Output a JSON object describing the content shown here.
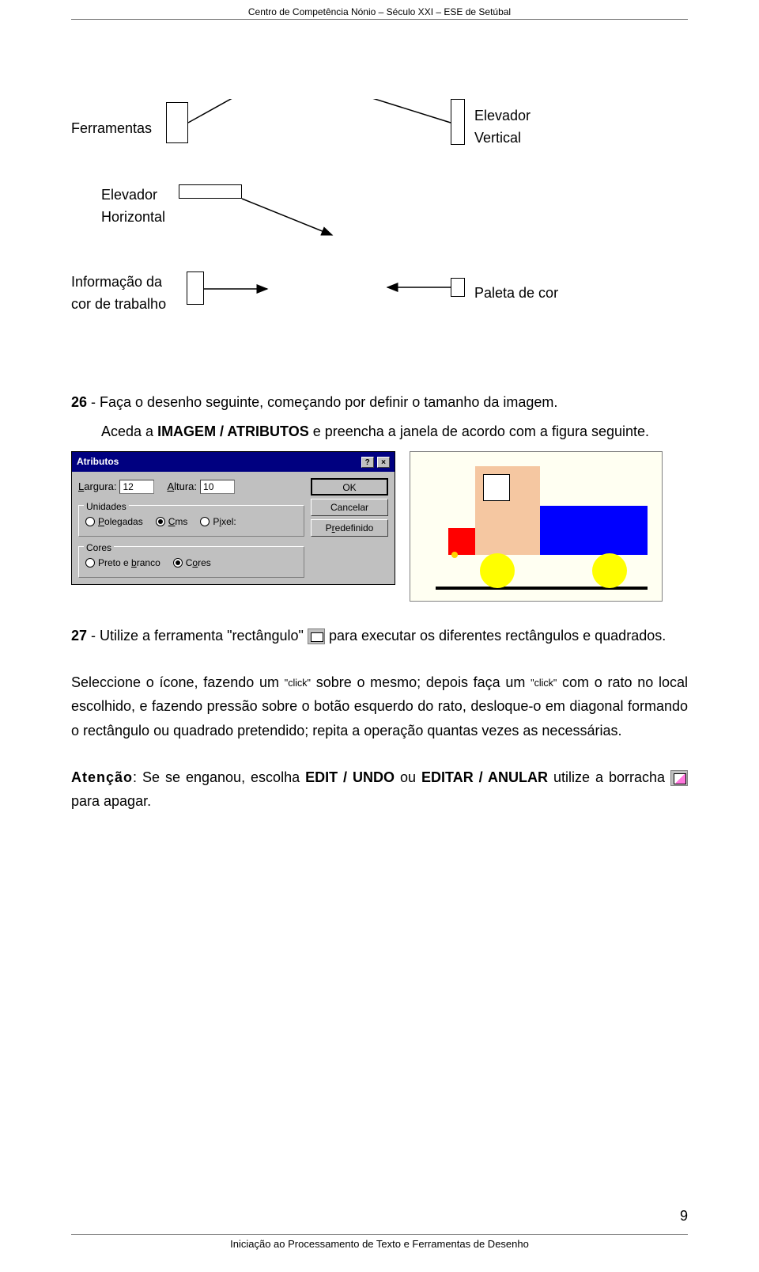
{
  "header": {
    "title": "Centro de Competência Nónio – Século XXI – ESE de Setúbal"
  },
  "diagram": {
    "ferramentas": "Ferramentas",
    "elevador_v1": "Elevador",
    "elevador_v2": "Vertical",
    "elevador_h1": "Elevador",
    "elevador_h2": "Horizontal",
    "info1": "Informação da",
    "info2": "cor de trabalho",
    "paleta": "Paleta de cor"
  },
  "step26": {
    "num": "26",
    "text_a": " - Faça o desenho seguinte, começando por definir o tamanho da imagem.",
    "text_b1": "Aceda a ",
    "text_b_bold": "IMAGEM / ATRIBUTOS",
    "text_b2": " e preencha a janela de acordo com a figura seguinte."
  },
  "dialog": {
    "title": "Atributos",
    "help": "?",
    "close": "×",
    "largura_lbl": "Largura:",
    "largura_val": "12",
    "altura_lbl": "Altura:",
    "altura_val": "10",
    "grp_unidades": "Unidades",
    "u_pol": "Polegadas",
    "u_cms": "Cms",
    "u_pix": "Pixel:",
    "grp_cores": "Cores",
    "c_pb": "Preto e branco",
    "c_cor": "Cores",
    "btn_ok": "OK",
    "btn_cancel": "Cancelar",
    "btn_predef": "Predefinido"
  },
  "step27": {
    "num": "27",
    "a": " - Utilize a ferramenta \"rectângulo\" ",
    "b": " para executar os diferentes rectângulos e quadrados.",
    "p2_a": "Seleccione o ícone, fazendo um ",
    "click": "\"click\"",
    "p2_b": " sobre o mesmo; depois faça um ",
    "p2_c": " com o rato no local escolhido, e fazendo pressão sobre o botão esquerdo do rato, desloque-o em diagonal formando o rectângulo ou quadrado pretendido; repita a operação quantas vezes as necessárias.",
    "att_lbl": "Atenção",
    "att_a": ": Se se enganou, escolha ",
    "att_bold1": "EDIT / UNDO",
    "att_mid": " ou ",
    "att_bold2": "EDITAR / ANULAR",
    "att_b": " utilize a borracha ",
    "att_c": " para apagar."
  },
  "footer": {
    "title": "Iniciação ao Processamento de Texto e Ferramentas de Desenho",
    "page": "9"
  },
  "underlineChars": {
    "largura": "L",
    "altura": "A",
    "pol": "P",
    "cms": "C",
    "pix": "i",
    "pb": "b",
    "cores": "o",
    "pre": "r"
  }
}
